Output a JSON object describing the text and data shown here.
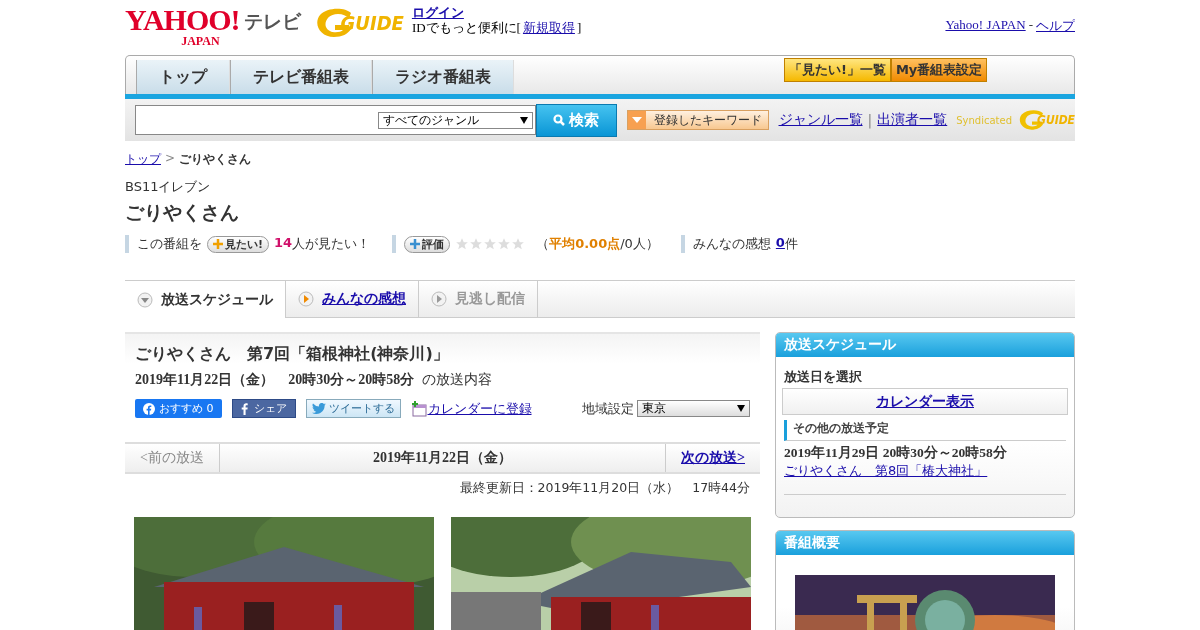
{
  "header": {
    "yahoo_logo": "YAHOO!",
    "yahoo_sub": "JAPAN",
    "service": "テレビ",
    "gguide_logo": "GUIDE",
    "login": "ログイン",
    "login_note": "IDでもっと便利に[",
    "signup": "新規取得",
    "login_note_end": "]",
    "yahoo_link": "Yahoo! JAPAN",
    "separator": "-",
    "help": "ヘルプ"
  },
  "nav": {
    "tabs": [
      {
        "label": "トップ"
      },
      {
        "label": "テレビ番組表"
      },
      {
        "label": "ラジオ番組表"
      }
    ],
    "buttons": [
      {
        "label": "「見たい!」一覧",
        "kind": "yellow"
      },
      {
        "label": "My番組表設定",
        "kind": "orange"
      }
    ]
  },
  "search": {
    "genre": "すべてのジャンル",
    "button": "検索",
    "keyword_button": "登録したキーワード",
    "genre_link": "ジャンル一覧",
    "divider": "|",
    "cast_link": "出演者一覧",
    "syndicated": "Syndicated",
    "syndicated_logo": "GUIDE"
  },
  "breadcrumb": {
    "top": "トップ",
    "sep": ">",
    "current": "ごりやくさん"
  },
  "channel": "BS11イレブン",
  "title": "ごりやくさん",
  "actions": {
    "want_prefix": "この番組を",
    "want_button": "見たい!",
    "want_count": "14",
    "want_suffix": "人が見たい！",
    "rate_button": "評価",
    "stars": 0,
    "avg_open": "（",
    "avg": "平均0.00点",
    "avg_rest": "/0人）",
    "review_label": "みんなの感想",
    "review_count": "0",
    "review_unit": "件"
  },
  "content_tabs": [
    {
      "label": "放送スケジュール",
      "selected": true,
      "kind": "current"
    },
    {
      "label": "みんなの感想",
      "selected": false,
      "kind": "link"
    },
    {
      "label": "見逃し配信",
      "selected": false,
      "kind": "disabled"
    }
  ],
  "episode": {
    "title": "ごりやくさん　第7回「箱根神社(神奈川)」",
    "datetime": "2019年11月22日（金）　20時30分～20時58分",
    "datetime_suffix": "の放送内容",
    "fb_recommend": "おすすめ 0",
    "fb_share": "シェア",
    "tweet": "ツイートする",
    "calendar": "カレンダーに登録",
    "region_label": "地域設定",
    "region": "東京"
  },
  "pager": {
    "prev": "<前の放送",
    "date": "2019年11月22日（金）",
    "next": "次の放送>"
  },
  "updated": "最終更新日：2019年11月20日（水）　17時44分",
  "sidebar": {
    "schedule": {
      "heading": "放送スケジュール",
      "select_label": "放送日を選択",
      "calendar_link": "カレンダー表示",
      "other_heading": "その他の放送予定",
      "items": [
        {
          "datetime": "2019年11月29日  20時30分～20時58分",
          "title": "ごりやくさん　第8回「椿大神社」"
        }
      ]
    },
    "overview": {
      "heading": "番組概要"
    }
  }
}
